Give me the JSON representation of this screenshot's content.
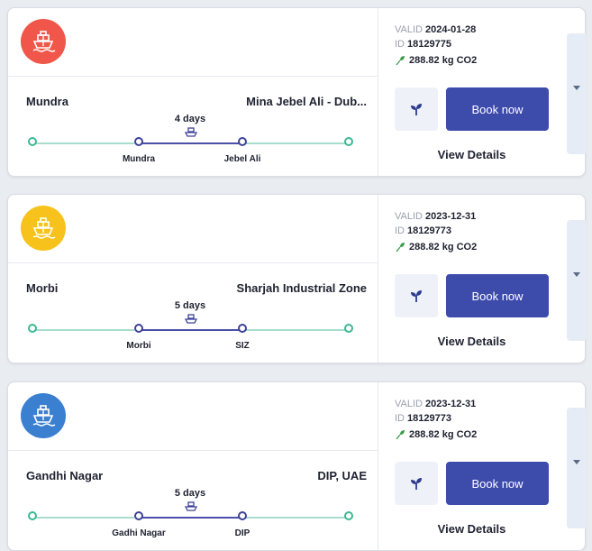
{
  "quotes": [
    {
      "logo_icon": "ship-icon",
      "logo_color": "#f0574a",
      "valid_label": "VALID",
      "valid_date": "2024-01-28",
      "id_label": "ID",
      "id_value": "18129775",
      "co2": "288.82 kg CO2",
      "origin": "Mundra",
      "destination": "Mina Jebel Ali - Dub...",
      "transit": "4 days",
      "origin_port": "Mundra",
      "destination_port": "Jebel Ali",
      "book_label": "Book now",
      "details_label": "View Details"
    },
    {
      "logo_icon": "ship-icon",
      "logo_color": "#f7c21b",
      "valid_label": "VALID",
      "valid_date": "2023-12-31",
      "id_label": "ID",
      "id_value": "18129773",
      "co2": "288.82 kg CO2",
      "origin": "Morbi",
      "destination": "Sharjah Industrial Zone",
      "transit": "5 days",
      "origin_port": "Morbi",
      "destination_port": "SIZ",
      "book_label": "Book now",
      "details_label": "View Details"
    },
    {
      "logo_icon": "ship-icon",
      "logo_color": "#3a7fd0",
      "valid_label": "VALID",
      "valid_date": "2023-12-31",
      "id_label": "ID",
      "id_value": "18129773",
      "co2": "288.82 kg CO2",
      "origin": "Gandhi Nagar",
      "destination": "DIP, UAE",
      "transit": "5 days",
      "origin_port": "Gadhi Nagar",
      "destination_port": "DIP",
      "book_label": "Book now",
      "details_label": "View Details"
    }
  ],
  "colors": {
    "primary": "#3d4bab",
    "teal": "#3db892",
    "purple": "#3d4296",
    "leaf": "#3a9a4a"
  }
}
